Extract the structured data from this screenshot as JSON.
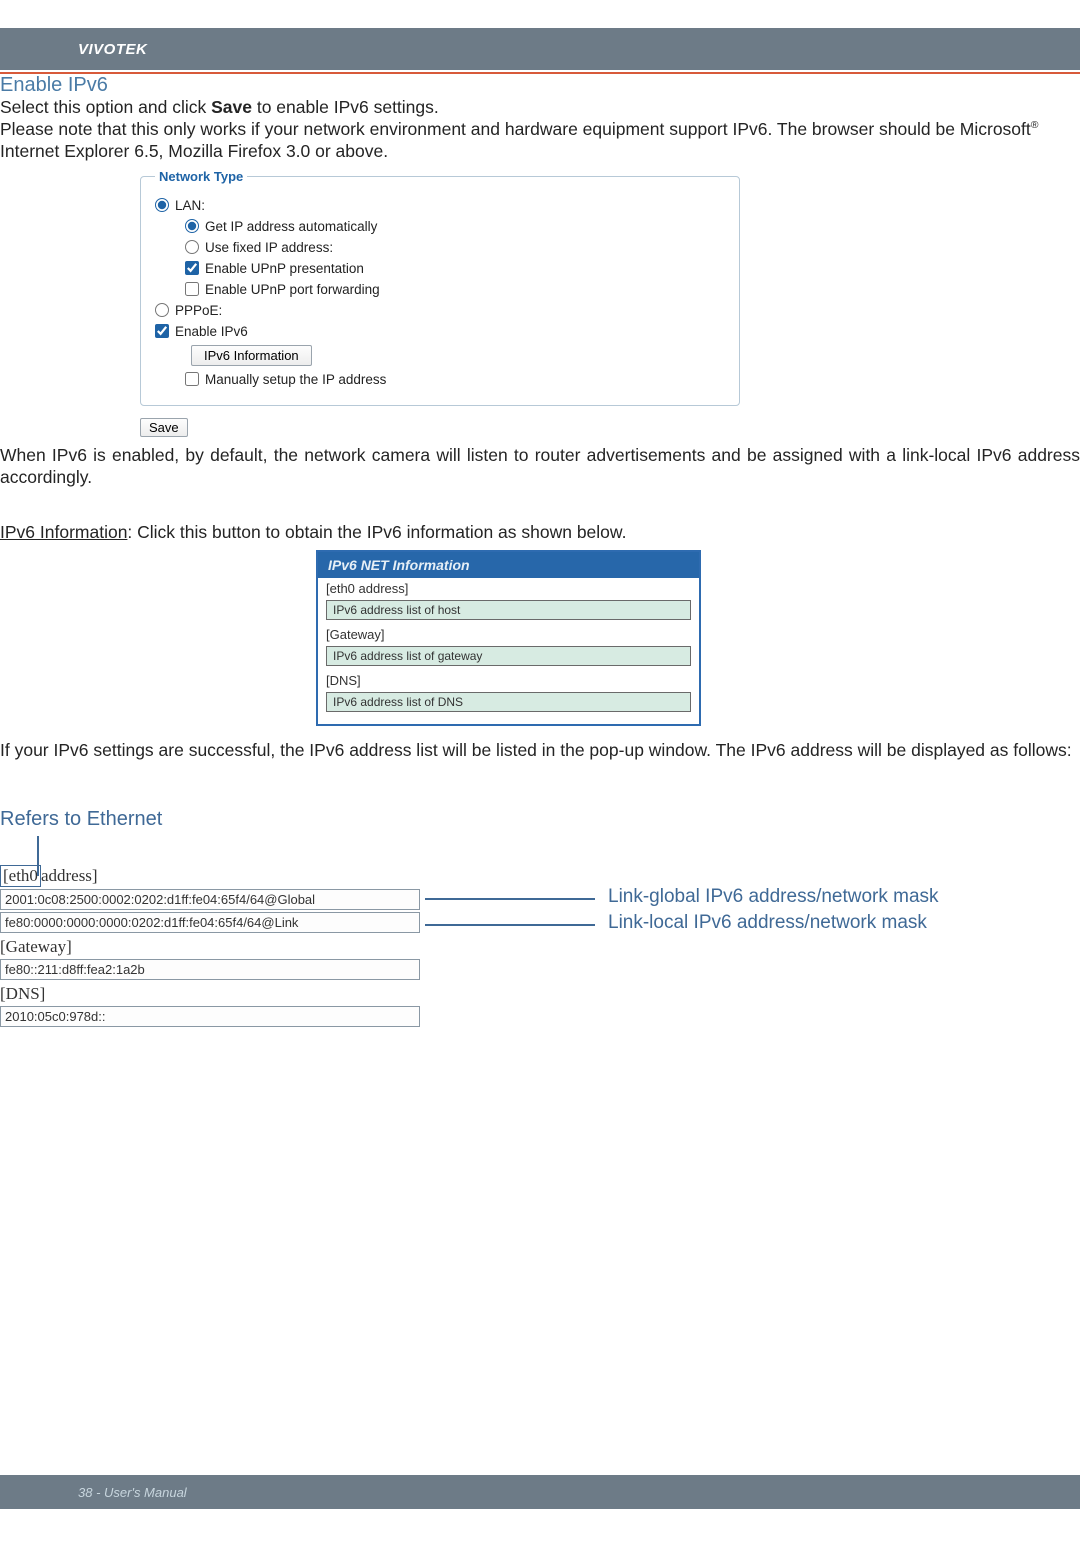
{
  "brand": "VIVOTEK",
  "heading": "Enable IPv6",
  "intro_pre": "Select this option and click ",
  "intro_bold": "Save",
  "intro_post": " to enable IPv6 settings.",
  "intro_line2_a": "Please note that this only works if your network environment and hardware equipment support IPv6. The browser should be Microsoft",
  "intro_line2_b": " Internet Explorer 6.5, Mozilla Firefox 3.0 or above.",
  "panel": {
    "legend": "Network Type",
    "lan": "LAN:",
    "get_ip": "Get IP address automatically",
    "fixed_ip": "Use fixed IP address:",
    "upnp_pres": "Enable UPnP presentation",
    "upnp_port": "Enable UPnP port forwarding",
    "pppoe": "PPPoE:",
    "enable_ipv6": "Enable IPv6",
    "ipv6_info_btn": "IPv6 Information",
    "manual_ip": "Manually setup the IP address",
    "save": "Save"
  },
  "after_panel": "When IPv6 is enabled, by default, the network camera will listen to router advertisements and be assigned with a link-local IPv6 address accordingly.",
  "ipv6_info_label": "IPv6 Information",
  "ipv6_info_text": ": Click this button to obtain the IPv6 information as shown below.",
  "info_box": {
    "title": "IPv6 NET Information",
    "r1": "[eth0 address]",
    "c1": "IPv6 address list of host",
    "r2": "[Gateway]",
    "c2": "IPv6 address list of gateway",
    "r3": "[DNS]",
    "c3": "IPv6 address list of DNS"
  },
  "after_box": "If your IPv6 settings are successful, the IPv6 address list will be listed in the pop-up window. The IPv6 address will be displayed as follows:",
  "refers": "Refers to Ethernet",
  "addr": {
    "eth_left": "[eth0",
    "eth_right": "address]",
    "global": "2001:0c08:2500:0002:0202:d1ff:fe04:65f4/64@Global",
    "link": "fe80:0000:0000:0000:0202:d1ff:fe04:65f4/64@Link",
    "gateway_lbl": "[Gateway]",
    "gateway_val": "fe80::211:d8ff:fea2:1a2b",
    "dns_lbl": "[DNS]",
    "dns_val": "2010:05c0:978d::"
  },
  "lead_global": "Link-global IPv6 address/network mask",
  "lead_link": "Link-local IPv6 address/network mask",
  "footer": "38 - User's Manual"
}
